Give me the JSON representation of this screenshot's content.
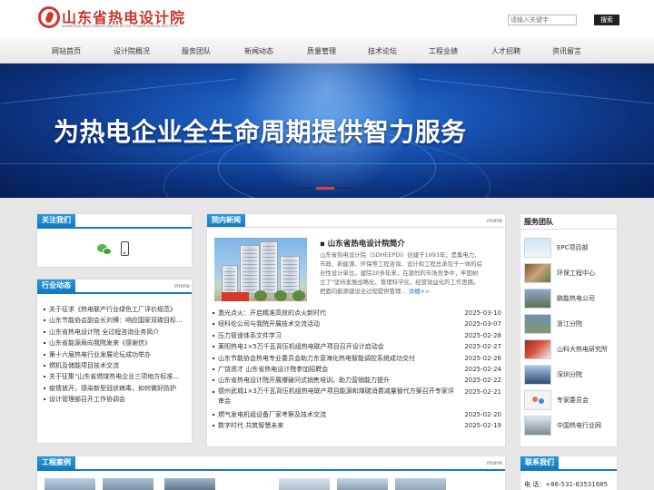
{
  "header": {
    "logo_text": "山东省热电设计院",
    "logo_sub": "SHANDONG HEAT ENERGY AND ELECTRIC POWER DESIGN INSTITUTE",
    "search_placeholder": "请输入关键字",
    "search_button": "搜索"
  },
  "nav": [
    "网站首页",
    "设计院概况",
    "服务团队",
    "新闻动态",
    "质量管理",
    "技术论坛",
    "工程业绩",
    "人才招聘",
    "资讯留言"
  ],
  "banner": {
    "headline": "为热电企业全生命周期提供智力服务",
    "slide_count": 4,
    "active_slide": 1
  },
  "follow": {
    "title": "关注我们"
  },
  "industry": {
    "title": "行业动态",
    "more": "more",
    "items": [
      "关于征求《热电联产行业绿色工厂评价规范》",
      "山东节能协会副会长刘博：响应国家双碳目标...",
      "山东省热电设计院 全过程咨询业务简介",
      "山东省能源局向我院发来《感谢信》",
      "第十六届热电行业发展论坛成功举办",
      "燃机及储能项目技术交流",
      "关于征集\"山东省燃煤热电企业三项地方标准...",
      "疫情放开，感染新型冠状病毒，如何做好防护",
      "设计管理部召开工作协调会"
    ]
  },
  "news": {
    "title": "院内新闻",
    "more": "more",
    "intro_title": "山东省热电设计院简介",
    "intro_body": "山东省热电设计院（SDHEEPDI）创建于1993年，是集电力、市政、新能源、环保等工程咨询、设计和工程总承包于一体的综合性设计单位。建院20多年来，在激烈的市场竞争中，牢固树立了\"坚持发展战略化、管理科学化、经营效益化的工作思路。把面向能源建设全过程提供管理...",
    "intro_more": "详细>>",
    "items": [
      {
        "title": "激光点火：开启精准高效的点火新时代",
        "date": "2025-03-10"
      },
      {
        "title": "纽科伦公司与我院开展技术交流活动",
        "date": "2025-03-07"
      },
      {
        "title": "压力管道体系文件学习",
        "date": "2025-02-28"
      },
      {
        "title": "莱阳热电1×5万千瓦背压机组热电联产项目召开设计启动会",
        "date": "2025-02-27"
      },
      {
        "title": "山东节能协会热电专业委员会助力东营海化热电智能调控系统成功交付",
        "date": "2025-02-26"
      },
      {
        "title": "广饶贤才 山东省热电设计院参加招聘会",
        "date": "2025-02-24"
      },
      {
        "title": "山东省热电设计院开展爆破问式销售培训。助力营销能力提升",
        "date": "2025-02-22"
      },
      {
        "title": "德州武城1×3万千瓦背压机组热电联产项目能源和煤碳消费减量替代方案召开专家评审会",
        "date": "2025-02-21"
      },
      {
        "title": "燃气发电机组设备厂家考察及技术交流",
        "date": "2025-02-20"
      },
      {
        "title": "数字时代 共筑智慧未来",
        "date": "2025-02-19"
      }
    ]
  },
  "services": {
    "title": "服务团队",
    "items": [
      "EPC项目部",
      "环保工程中心",
      "鹏能热电公司",
      "浙江分院",
      "山科大热电研究所",
      "深圳分院",
      "专家委员会",
      "中国热电行业网"
    ]
  },
  "cases": {
    "title": "工程案例",
    "more": "more"
  },
  "contact": {
    "title": "联系我们",
    "phone_label": "电  话：",
    "phone": "+86-531-83531685"
  },
  "colors": {
    "accent": "#1479c3",
    "brand_red": "#c8342a",
    "banner_blue": "#1651b0"
  }
}
